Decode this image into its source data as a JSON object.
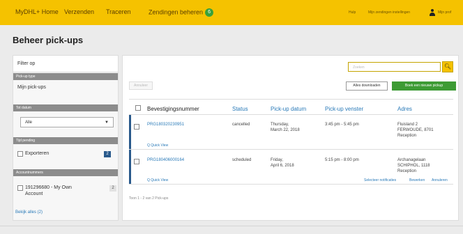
{
  "nav": {
    "home": "MyDHL+ Home",
    "send": "Verzenden",
    "track": "Traceren",
    "manage": "Zendingen beheren",
    "manage_badge": "6",
    "help": "Hulp",
    "settings": "Mijn zendingen instellingen",
    "profile": "Mijn prof"
  },
  "page_title": "Beheer pick-ups",
  "sidebar": {
    "filter_label": "Filter op",
    "pickup_type_header": "Pick-up type",
    "my_pickups": "Mijn pick-ups",
    "date_header": "Tot datum",
    "date_value": "Alle",
    "pending_header": "Tijd pending",
    "export_label": "Exporteren",
    "export_count": "2",
    "accounts_header": "Accountnummers",
    "account_label_1": "191296680 - My Own",
    "account_label_2": "Account",
    "account_count": "2",
    "show_all": "Bekijk alles (2)"
  },
  "main": {
    "search_placeholder": "Zoeken",
    "cancel_label": "Annuleer",
    "export_all_label": "Alles downloaden",
    "new_pickup_label": "Boek een nieuwe pickup",
    "columns": [
      "Bevestigingsnummer",
      "Status",
      "Pick-up datum",
      "Pick-up venster",
      "Adres"
    ],
    "rows": [
      {
        "number": "PRG180320230951",
        "status": "cancelled",
        "date_1": "Thursday,",
        "date_2": "March 22, 2018",
        "window": "3:45 pm - 5:45 pm",
        "addr_1": "Fluisland 2",
        "addr_2": "FERWOUDE, 8701",
        "addr_3": "Reception",
        "quick_view": "Q Quick View"
      },
      {
        "number": "PRG180406000164",
        "status": "scheduled",
        "date_1": "Friday,",
        "date_2": "April 6, 2018",
        "window": "5:15 pm - 8:00 pm",
        "addr_1": "Archanagelaan",
        "addr_2": "SCHIPHOL, 1118",
        "addr_3": "Reception",
        "quick_view": "Q Quick View",
        "actions": [
          "Selecteer notificaties",
          "Bewerken",
          "Annuleren"
        ]
      }
    ],
    "summary": "Toon 1 - 2 van 2 Pick-ups"
  },
  "colors": {
    "brand_yellow": "#f5c200",
    "link_blue": "#2a7ab8",
    "action_green": "#3d9b34"
  }
}
